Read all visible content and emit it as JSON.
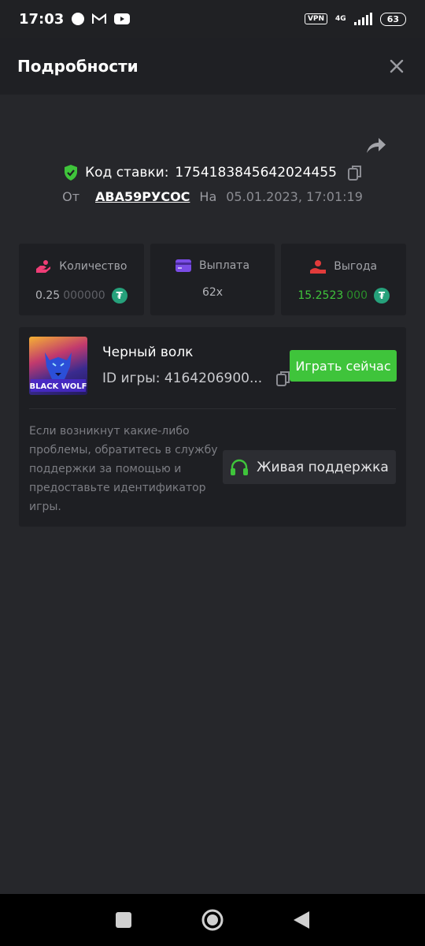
{
  "status_bar": {
    "time": "17:03",
    "vpn": "VPN",
    "network": "4G",
    "battery": "63"
  },
  "header": {
    "title": "Подробности"
  },
  "bet": {
    "code_label": "Код ставки:",
    "code_value": "1754183845642024455",
    "from_label": "От",
    "from_user": "АВА59РУСОС",
    "on_label": "На",
    "date": "05.01.2023, 17:01:19"
  },
  "stats": {
    "quantity": {
      "label": "Количество",
      "value_main": "0.25",
      "value_tail": "000000"
    },
    "payout": {
      "label": "Выплата",
      "value": "62x"
    },
    "profit": {
      "label": "Выгода",
      "value_main": "15.2523",
      "value_tail": "000"
    }
  },
  "game": {
    "name": "Черный волк",
    "id_text": "ID игры: 4164206900...",
    "thumb_caption": "BLACK WOLF",
    "play_label": "Играть сейчас"
  },
  "support": {
    "help_text": "Если возникнут какие-либо проблемы, обратитесь в службу поддержки за помощью и предоставьте идентификатор игры.",
    "button_label": "Живая поддержка"
  },
  "colors": {
    "accent_green": "#3fc43b",
    "background": "#26272b",
    "card": "#1e1f23",
    "tether": "#26a17b"
  }
}
